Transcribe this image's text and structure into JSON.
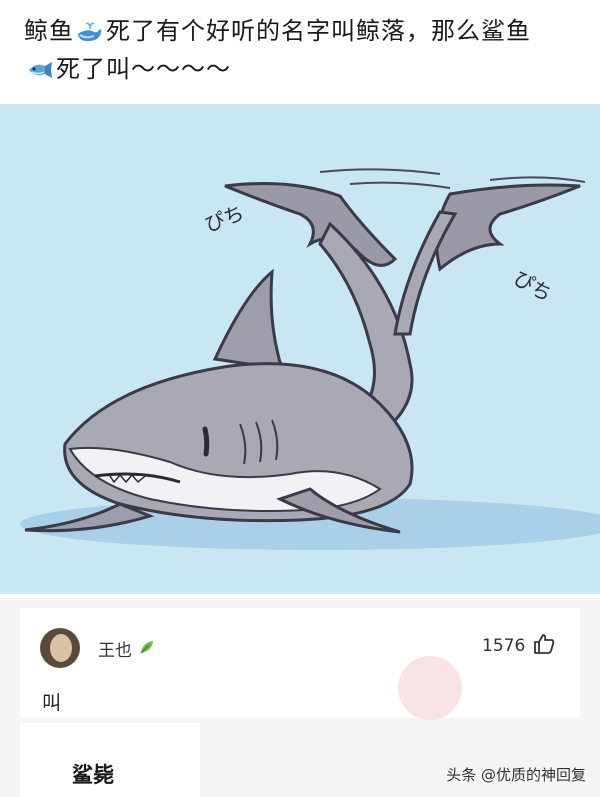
{
  "post": {
    "line1_a": "鲸鱼",
    "line1_b": "死了有个好听的名字叫鲸落，那么鲨鱼",
    "line2": "死了叫～～～～",
    "emoji_whale": "whale-emoji",
    "emoji_fish": "fish-emoji"
  },
  "image": {
    "sfx_left": "ぴち",
    "sfx_right": "ぴち"
  },
  "comment": {
    "username": "王也",
    "likes": "1576",
    "text": "叫"
  },
  "reply": {
    "text": "鲨毙"
  },
  "credit": "头条 @优质的神回复",
  "colors": {
    "sky": "#c9e6f3",
    "shark_body": "#a9a9b3",
    "shark_belly": "#f3f0f6",
    "outline": "#3a3a48"
  }
}
